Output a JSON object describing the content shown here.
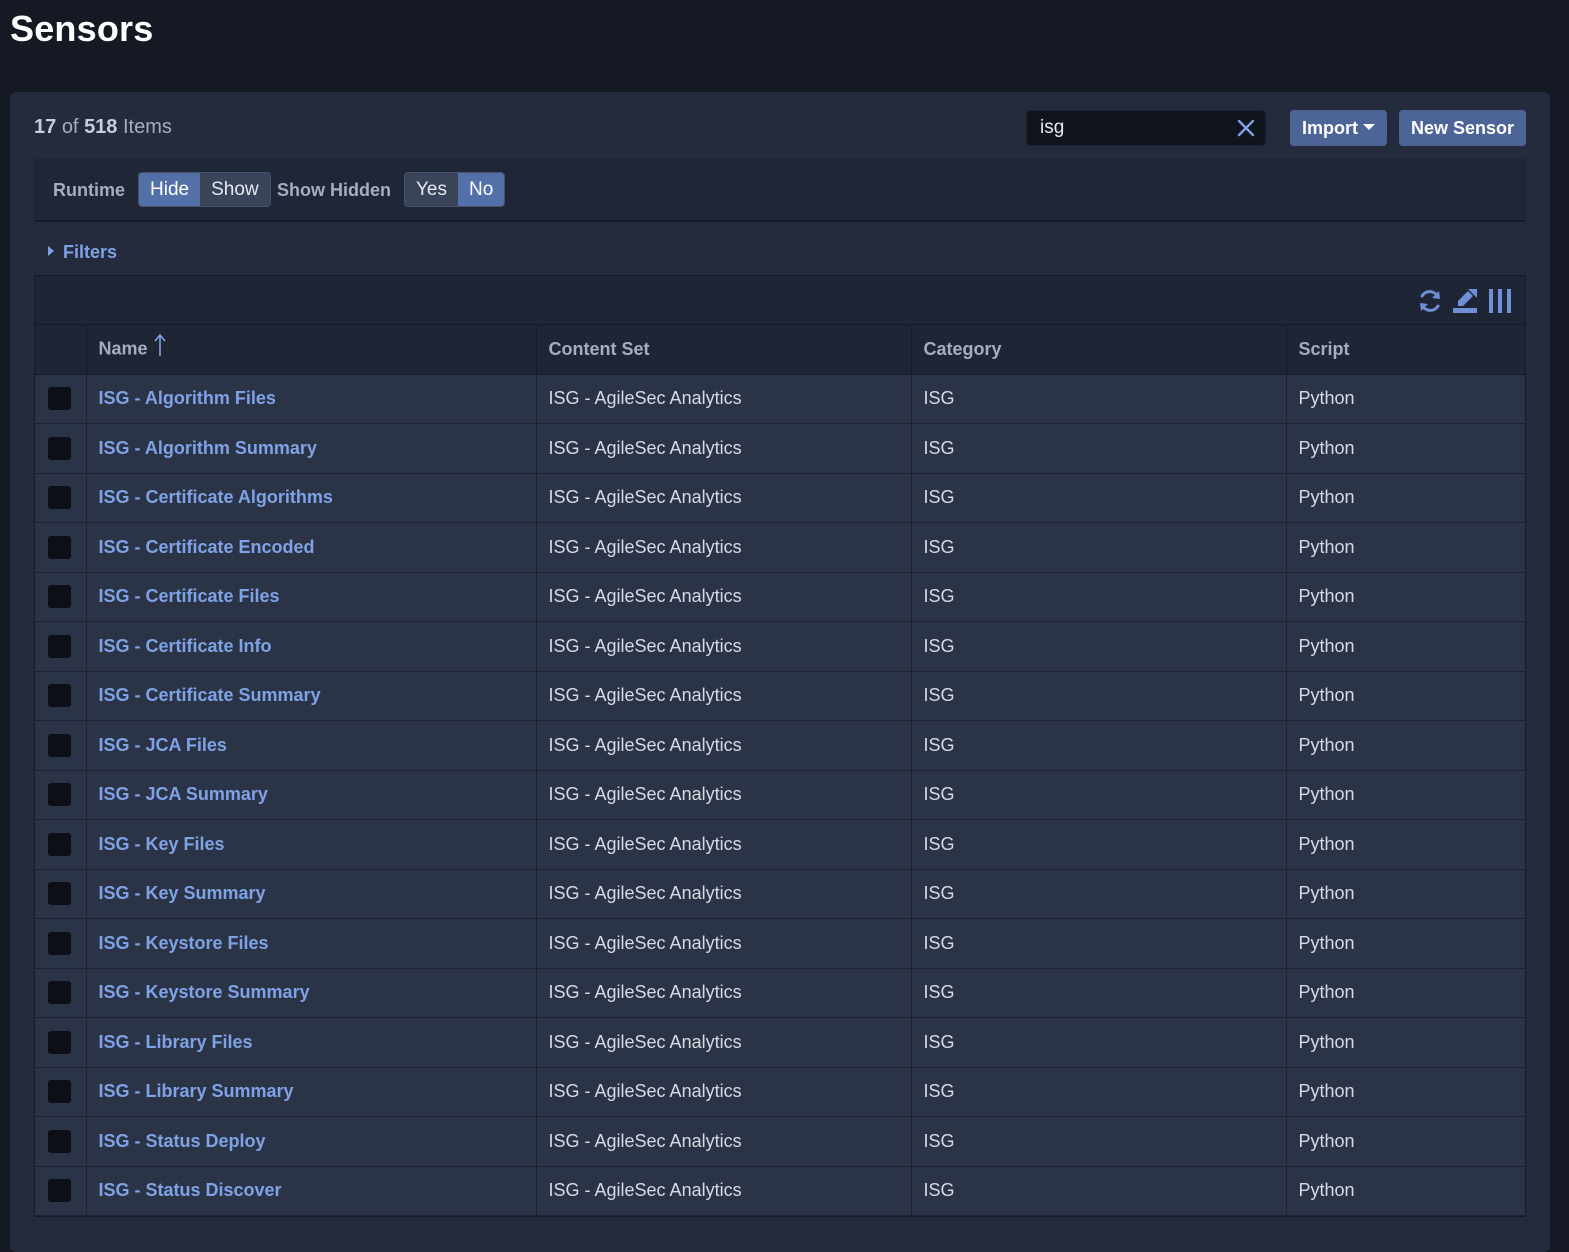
{
  "page": {
    "title": "Sensors"
  },
  "summary": {
    "shown": "17",
    "of_text": "of",
    "total": "518",
    "items_text": "Items"
  },
  "search": {
    "value": "isg"
  },
  "buttons": {
    "import_label": "Import",
    "new_sensor_label": "New Sensor"
  },
  "toggles": {
    "runtime": {
      "label": "Runtime",
      "options": [
        "Hide",
        "Show"
      ],
      "selected": "Hide"
    },
    "show_hidden": {
      "label": "Show Hidden",
      "options": [
        "Yes",
        "No"
      ],
      "selected": "No"
    }
  },
  "filters": {
    "label": "Filters",
    "expanded": false
  },
  "toolbar": {
    "icons": [
      "refresh-icon",
      "export-icon",
      "columns-icon"
    ]
  },
  "table": {
    "columns": [
      "Name",
      "Content Set",
      "Category",
      "Script"
    ],
    "sort": {
      "column": "Name",
      "direction": "ascending"
    },
    "rows": [
      {
        "name": "ISG - Algorithm Files",
        "content_set": "ISG - AgileSec Analytics",
        "category": "ISG",
        "script": "Python"
      },
      {
        "name": "ISG - Algorithm Summary",
        "content_set": "ISG - AgileSec Analytics",
        "category": "ISG",
        "script": "Python"
      },
      {
        "name": "ISG - Certificate Algorithms",
        "content_set": "ISG - AgileSec Analytics",
        "category": "ISG",
        "script": "Python"
      },
      {
        "name": "ISG - Certificate Encoded",
        "content_set": "ISG - AgileSec Analytics",
        "category": "ISG",
        "script": "Python"
      },
      {
        "name": "ISG - Certificate Files",
        "content_set": "ISG - AgileSec Analytics",
        "category": "ISG",
        "script": "Python"
      },
      {
        "name": "ISG - Certificate Info",
        "content_set": "ISG - AgileSec Analytics",
        "category": "ISG",
        "script": "Python"
      },
      {
        "name": "ISG - Certificate Summary",
        "content_set": "ISG - AgileSec Analytics",
        "category": "ISG",
        "script": "Python"
      },
      {
        "name": "ISG - JCA Files",
        "content_set": "ISG - AgileSec Analytics",
        "category": "ISG",
        "script": "Python"
      },
      {
        "name": "ISG - JCA Summary",
        "content_set": "ISG - AgileSec Analytics",
        "category": "ISG",
        "script": "Python"
      },
      {
        "name": "ISG - Key Files",
        "content_set": "ISG - AgileSec Analytics",
        "category": "ISG",
        "script": "Python"
      },
      {
        "name": "ISG - Key Summary",
        "content_set": "ISG - AgileSec Analytics",
        "category": "ISG",
        "script": "Python"
      },
      {
        "name": "ISG - Keystore Files",
        "content_set": "ISG - AgileSec Analytics",
        "category": "ISG",
        "script": "Python"
      },
      {
        "name": "ISG - Keystore Summary",
        "content_set": "ISG - AgileSec Analytics",
        "category": "ISG",
        "script": "Python"
      },
      {
        "name": "ISG - Library Files",
        "content_set": "ISG - AgileSec Analytics",
        "category": "ISG",
        "script": "Python"
      },
      {
        "name": "ISG - Library Summary",
        "content_set": "ISG - AgileSec Analytics",
        "category": "ISG",
        "script": "Python"
      },
      {
        "name": "ISG - Status Deploy",
        "content_set": "ISG - AgileSec Analytics",
        "category": "ISG",
        "script": "Python"
      },
      {
        "name": "ISG - Status Discover",
        "content_set": "ISG - AgileSec Analytics",
        "category": "ISG",
        "script": "Python"
      }
    ]
  },
  "colors": {
    "background": "#141924",
    "panel": "#232b3d",
    "accent": "#4d6596",
    "link": "#7fa2e6",
    "row": "#2b3446"
  }
}
